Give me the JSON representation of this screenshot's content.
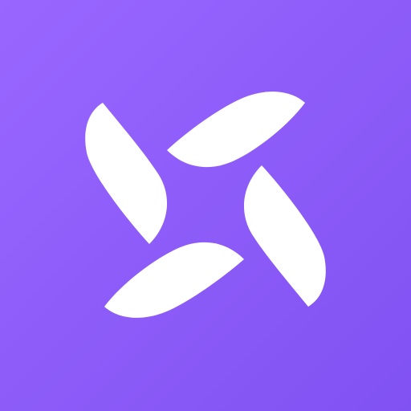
{
  "app_icon": {
    "icon_name": "pinwheel-icon",
    "colors": {
      "background_light": "#9966FF",
      "background_dark": "#8152F2",
      "foreground": "#FFFFFF"
    }
  }
}
